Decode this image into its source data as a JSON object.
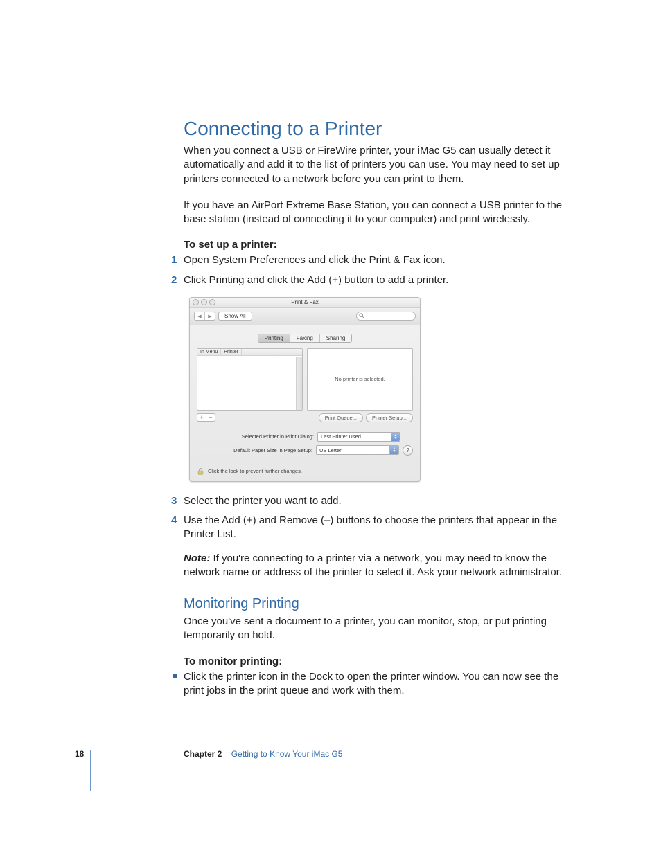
{
  "headings": {
    "main": "Connecting to a Printer",
    "sub": "Monitoring Printing"
  },
  "paragraphs": {
    "intro1": "When you connect a USB or FireWire printer, your iMac G5 can usually detect it automatically and add it to the list of printers you can use. You may need to set up printers connected to a network before you can print to them.",
    "intro2": "If you have an AirPort Extreme Base Station, you can connect a USB printer to the base station (instead of connecting it to your computer) and print wirelessly.",
    "setup_lead": "To set up a printer:",
    "note": "If you're connecting to a printer via a network, you may need to know the network name or address of the printer to select it. Ask your network administrator.",
    "note_label": "Note:  ",
    "monitor_intro": "Once you've sent a document to a printer, you can monitor, stop, or put printing temporarily on hold.",
    "monitor_lead": "To monitor printing:"
  },
  "steps": {
    "s1": "Open System Preferences and click the Print & Fax icon.",
    "s2": "Click Printing and click the Add (+) button to add a printer.",
    "s3": "Select the printer you want to add.",
    "s4": "Use the Add (+) and Remove (–) buttons to choose the printers that appear in the Printer List."
  },
  "bullets": {
    "b1": "Click the printer icon in the Dock to open the printer window. You can now see the print jobs in the print queue and work with them."
  },
  "window": {
    "title": "Print & Fax",
    "show_all": "Show All",
    "tabs": {
      "printing": "Printing",
      "faxing": "Faxing",
      "sharing": "Sharing"
    },
    "cols": {
      "inmenu": "In Menu",
      "printer": "Printer"
    },
    "no_printer": "No printer is selected.",
    "print_queue": "Print Queue...",
    "printer_setup": "Printer Setup...",
    "row1_label": "Selected Printer in Print Dialog:",
    "row1_value": "Last Printer Used",
    "row2_label": "Default Paper Size in Page Setup:",
    "row2_value": "US Letter",
    "lock_text": "Click the lock to prevent further changes."
  },
  "footer": {
    "page": "18",
    "chapter_label": "Chapter 2",
    "chapter_title": "Getting to Know Your iMac G5"
  }
}
